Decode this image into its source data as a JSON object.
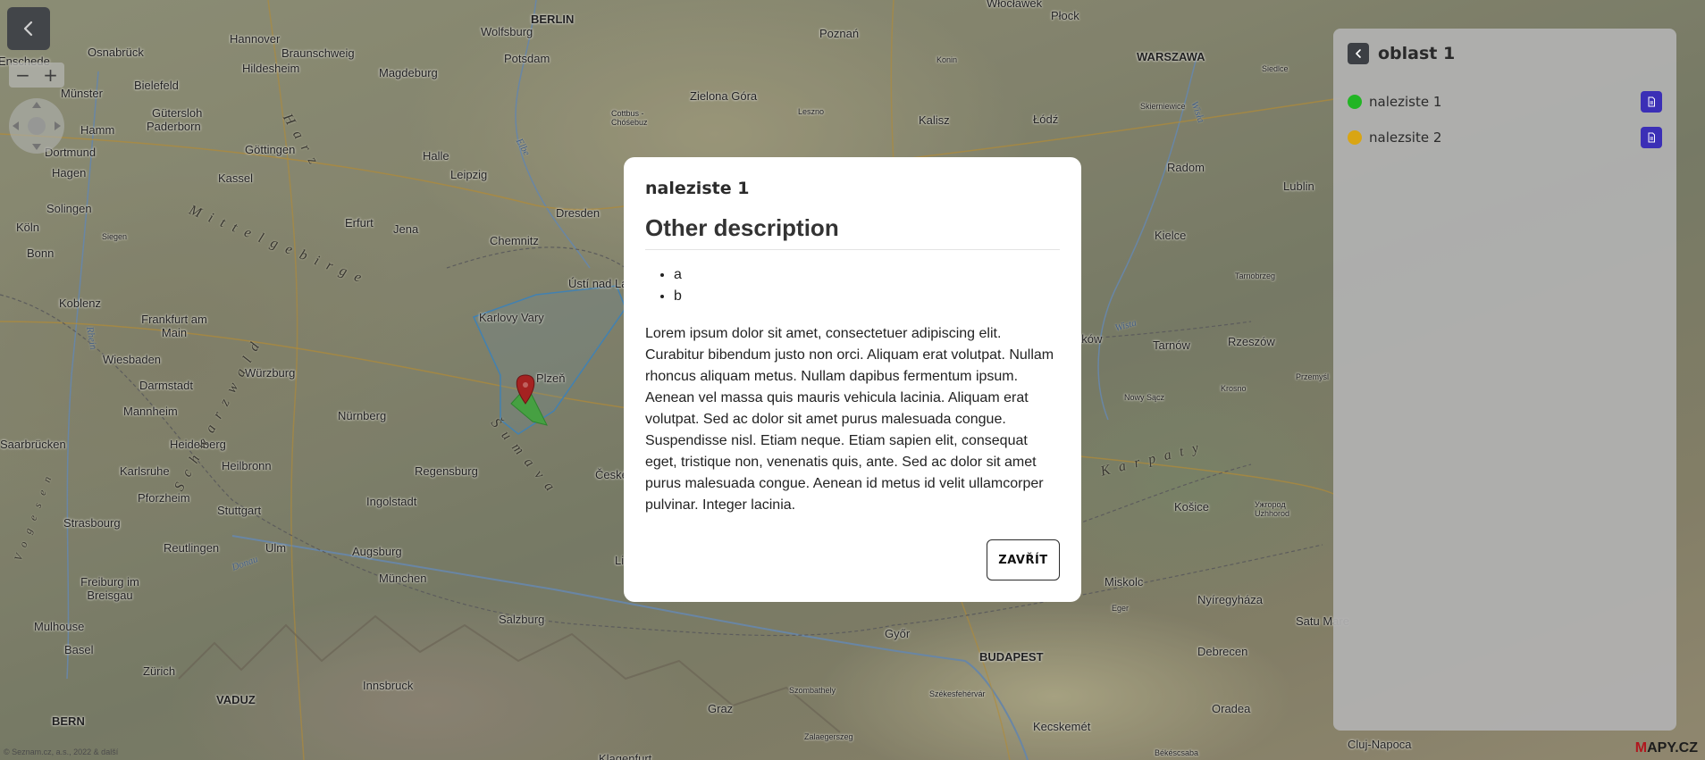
{
  "map": {
    "cities": [
      {
        "name": "Wolfsburg"
      },
      {
        "name": "BERLIN"
      },
      {
        "name": "Poznań"
      },
      {
        "name": "Włocławek"
      },
      {
        "name": "Płock"
      },
      {
        "name": "Osnabrück"
      },
      {
        "name": "Hannover"
      },
      {
        "name": "Braunschweig"
      },
      {
        "name": "Enschede"
      },
      {
        "name": "Potsdam"
      },
      {
        "name": "WARSZAWA"
      },
      {
        "name": "Siedlce"
      },
      {
        "name": "Hildesheim"
      },
      {
        "name": "Magdeburg"
      },
      {
        "name": "Konin"
      },
      {
        "name": "Zielona Góra"
      },
      {
        "name": "Münster"
      },
      {
        "name": "Bielefeld"
      },
      {
        "name": "Gütersloh"
      },
      {
        "name": "Paderborn"
      },
      {
        "name": "Hamm"
      },
      {
        "name": "Dortmund"
      },
      {
        "name": "Göttingen"
      },
      {
        "name": "Kalisz"
      },
      {
        "name": "Łódź"
      },
      {
        "name": "Skierniewice"
      },
      {
        "name": "Leszno"
      },
      {
        "name": "Cottbus - Chóśebuz"
      },
      {
        "name": "Halle"
      },
      {
        "name": "Leipzig"
      },
      {
        "name": "Kassel"
      },
      {
        "name": "Hagen"
      },
      {
        "name": "Radom"
      },
      {
        "name": "Lublin"
      },
      {
        "name": "Solingen"
      },
      {
        "name": "Dresden"
      },
      {
        "name": "Erfurt"
      },
      {
        "name": "Jena"
      },
      {
        "name": "Chemnitz"
      },
      {
        "name": "Köln"
      },
      {
        "name": "Siegen"
      },
      {
        "name": "Bonn"
      },
      {
        "name": "Kielce"
      },
      {
        "name": "Tarnobrzeg"
      },
      {
        "name": "Ústí nad Labem"
      },
      {
        "name": "Koblenz"
      },
      {
        "name": "Frankfurt am Main"
      },
      {
        "name": "Karlovy Vary"
      },
      {
        "name": "Wiesbaden"
      },
      {
        "name": "Würzburg"
      },
      {
        "name": "Darmstadt"
      },
      {
        "name": "Plzeň"
      },
      {
        "name": "Kraków"
      },
      {
        "name": "Tarnów"
      },
      {
        "name": "Rzeszów"
      },
      {
        "name": "Przemyśl"
      },
      {
        "name": "Mannheim"
      },
      {
        "name": "Nürnberg"
      },
      {
        "name": "Nowy Sącz"
      },
      {
        "name": "Krosno"
      },
      {
        "name": "Saarbrücken"
      },
      {
        "name": "Heidelberg"
      },
      {
        "name": "Karlsruhe"
      },
      {
        "name": "Heilbronn"
      },
      {
        "name": "Regensburg"
      },
      {
        "name": "České Budějovice"
      },
      {
        "name": "Ingolstadt"
      },
      {
        "name": "Pforzheim"
      },
      {
        "name": "Stuttgart"
      },
      {
        "name": "Košice"
      },
      {
        "name": "Ужгород Uzhhorod"
      },
      {
        "name": "Strasbourg"
      },
      {
        "name": "Reutlingen"
      },
      {
        "name": "Ulm"
      },
      {
        "name": "Augsburg"
      },
      {
        "name": "Linz"
      },
      {
        "name": "Miskolc"
      },
      {
        "name": "Freiburg im Breisgau"
      },
      {
        "name": "München"
      },
      {
        "name": "Nyíregyháza"
      },
      {
        "name": "Eger"
      },
      {
        "name": "Satu Mare"
      },
      {
        "name": "Mulhouse"
      },
      {
        "name": "Salzburg"
      },
      {
        "name": "Győr"
      },
      {
        "name": "BUDAPEST"
      },
      {
        "name": "Basel"
      },
      {
        "name": "Debrecen"
      },
      {
        "name": "Zürich"
      },
      {
        "name": "Szombathely"
      },
      {
        "name": "Székesfehérvár"
      },
      {
        "name": "VADUZ"
      },
      {
        "name": "Innsbruck"
      },
      {
        "name": "Graz"
      },
      {
        "name": "Kecskemét"
      },
      {
        "name": "Oradea"
      },
      {
        "name": "BERN"
      },
      {
        "name": "Zalaegerszeg"
      },
      {
        "name": "Cluj-Napoca"
      },
      {
        "name": "Békéscsaba"
      },
      {
        "name": "Klagenfurt"
      }
    ],
    "regions": [
      {
        "name": "Harz"
      },
      {
        "name": "Mittelgebirge"
      },
      {
        "name": "Šumava"
      },
      {
        "name": "Karpaty"
      },
      {
        "name": "Schwarzwald"
      },
      {
        "name": "Vogesen"
      }
    ],
    "rivers": [
      {
        "name": "Elbe"
      },
      {
        "name": "Wisła"
      },
      {
        "name": "Rhein"
      },
      {
        "name": "Donau"
      },
      {
        "name": "Wista"
      }
    ],
    "copyright": "© Seznam.cz, a.s., 2022 & další",
    "logo_text": "APY.CZ",
    "logo_letter": "M",
    "zoom_out": "−",
    "zoom_in": "+"
  },
  "panel": {
    "title": "oblast 1",
    "items": [
      {
        "label": "naleziste 1",
        "color": "#22b524"
      },
      {
        "label": "nalezsite 2",
        "color": "#d9a513"
      }
    ]
  },
  "modal": {
    "subtitle": "naleziste 1",
    "heading": "Other description",
    "list": [
      "a",
      "b"
    ],
    "paragraph": "Lorem ipsum dolor sit amet, consectetuer adipiscing elit. Curabitur bibendum justo non orci. Aliquam erat volutpat. Nullam rhoncus aliquam metus. Nullam dapibus fermentum ipsum. Aenean vel massa quis mauris vehicula lacinia. Aliquam erat volutpat. Sed ac dolor sit amet purus malesuada congue. Suspendisse nisl. Etiam neque. Etiam sapien elit, consequat eget, tristique non, venenatis quis, ante. Sed ac dolor sit amet purus malesuada congue. Aenean id metus id velit ullamcorper pulvinar. Integer lacinia.",
    "close_label": "ZAVŘÍT"
  },
  "colors": {
    "accent": "#3b2fb6",
    "marker": "#c8201f",
    "polygon": "#4fc24a"
  }
}
